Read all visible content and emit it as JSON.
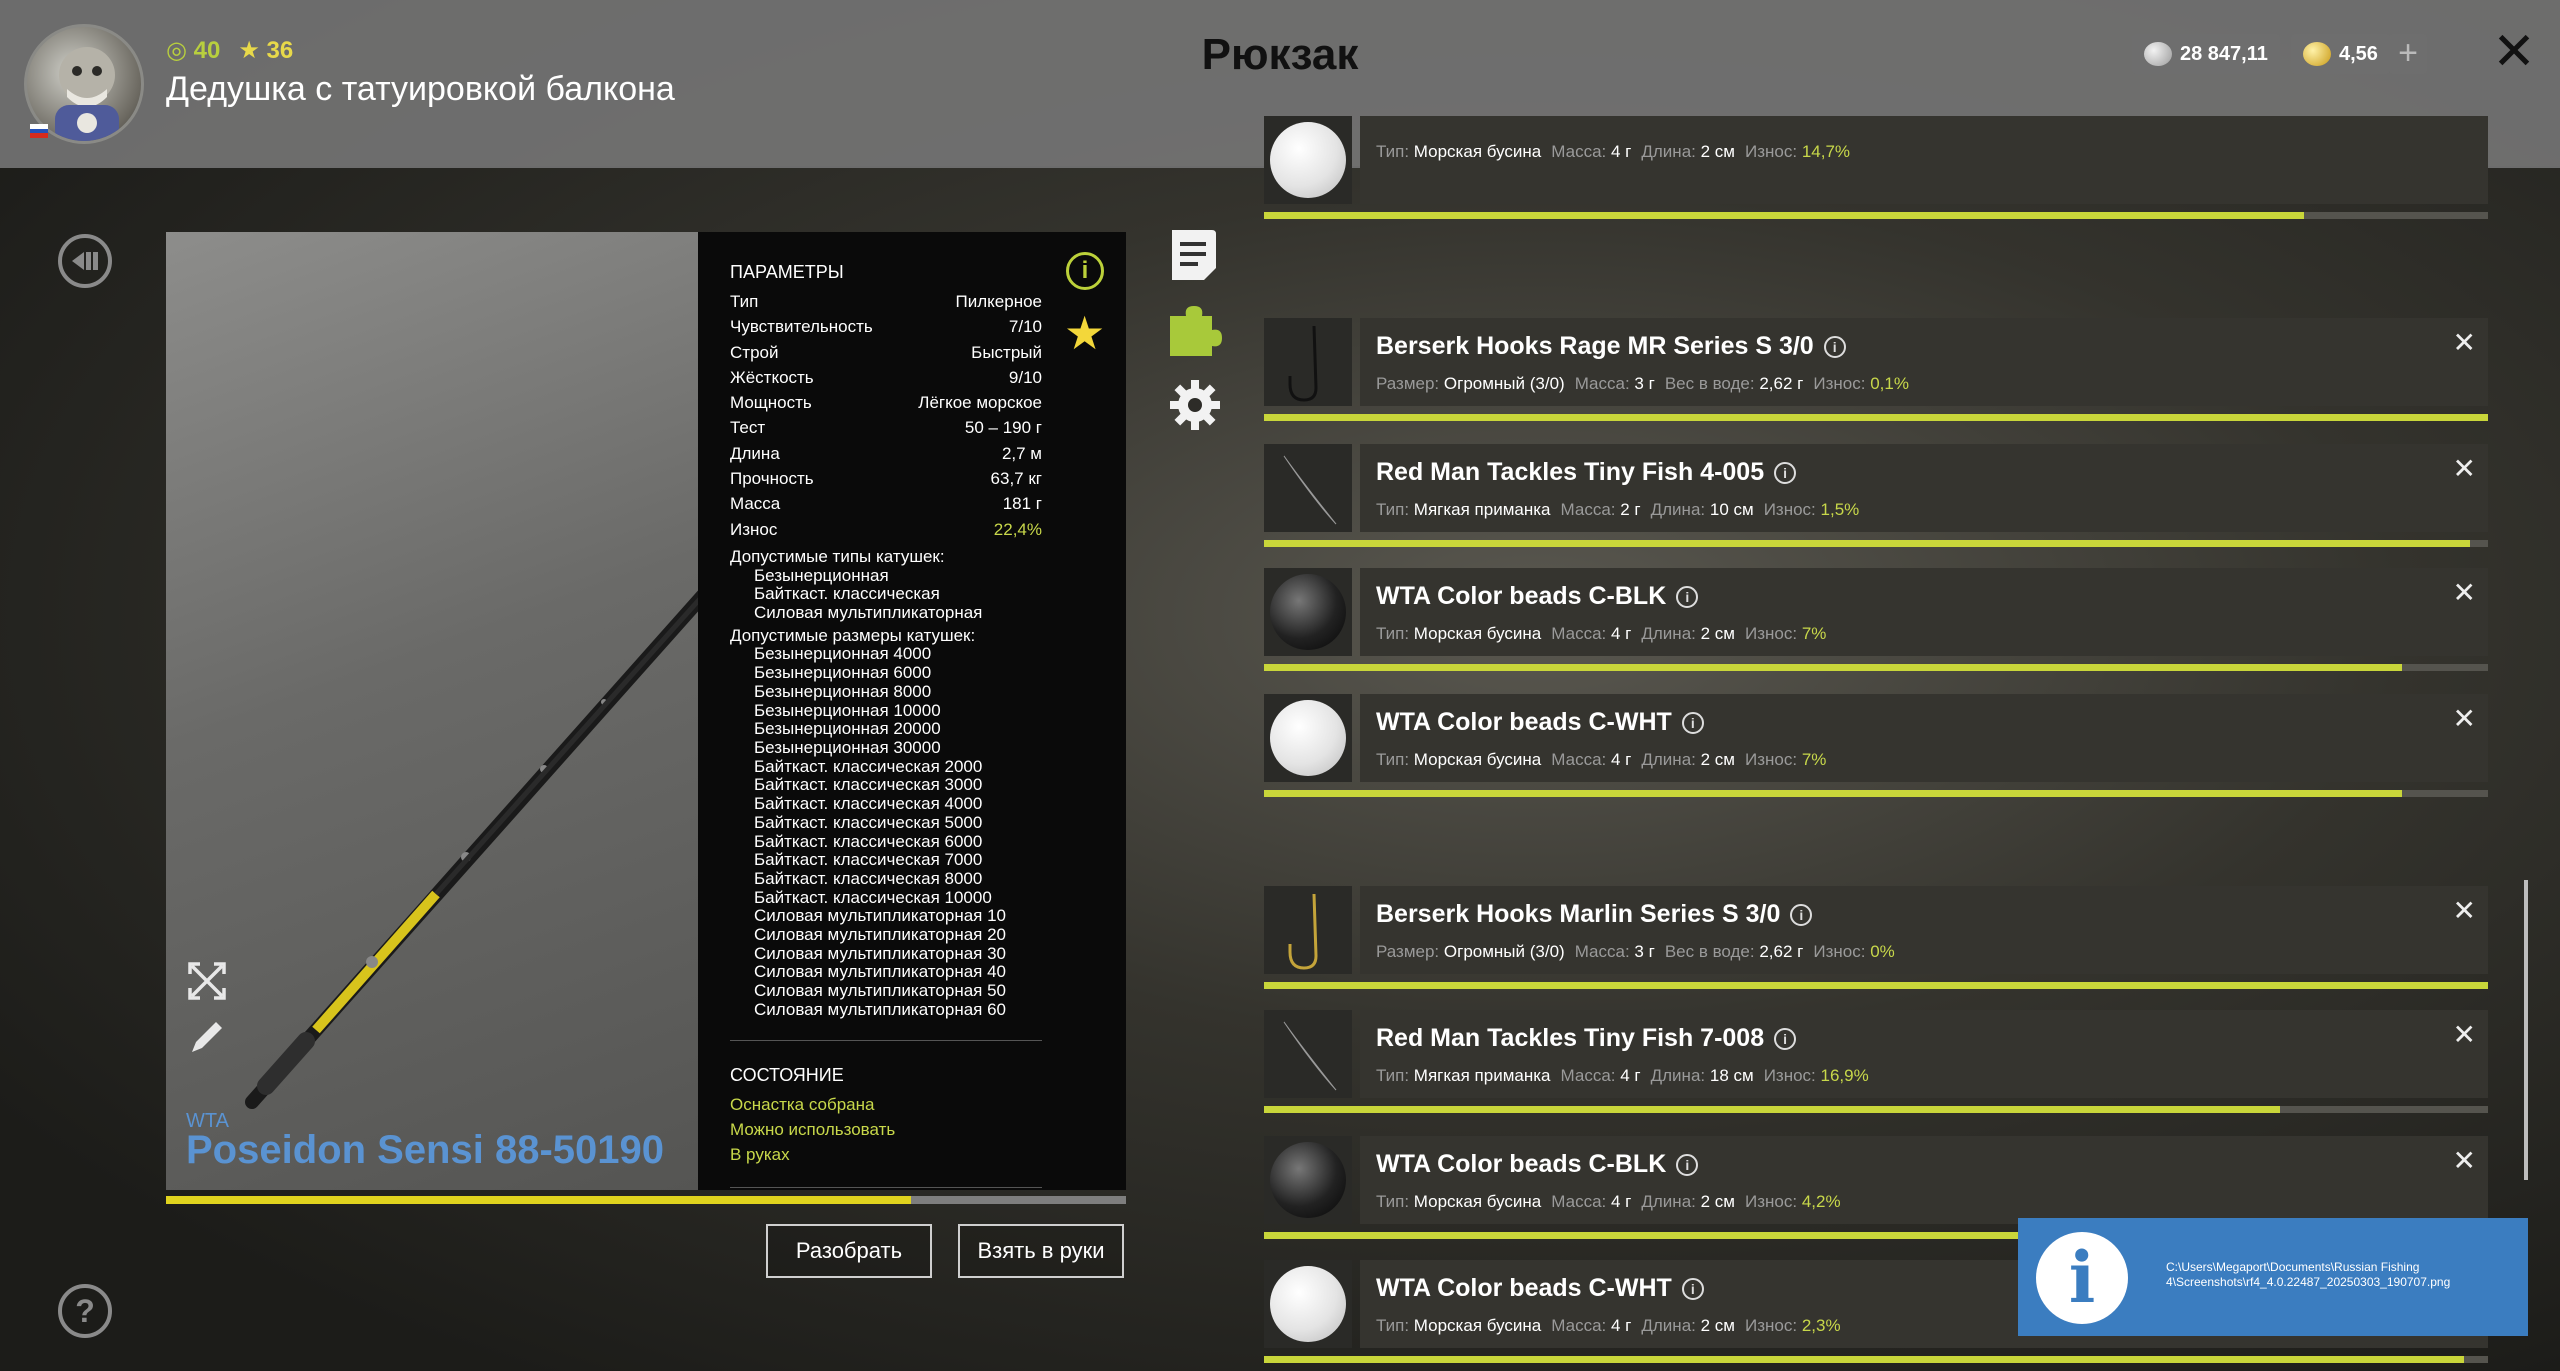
{
  "header": {
    "level": "40",
    "rank": "36",
    "player_name": "Дедушка с татуировкой балкона",
    "title": "Рюкзак",
    "silver": "28 847,11",
    "gold": "4,56",
    "plus": "+",
    "close": "✕"
  },
  "item": {
    "brand": "WTA",
    "name": "Poseidon Sensi 88-50190",
    "wear_fraction": 0.776,
    "params_title": "ПАРАМЕТРЫ",
    "params": [
      {
        "label": "Тип",
        "value": "Пилкерное"
      },
      {
        "label": "Чувствительность",
        "value": "7/10"
      },
      {
        "label": "Строй",
        "value": "Быстрый"
      },
      {
        "label": "Жёсткость",
        "value": "9/10"
      },
      {
        "label": "Мощность",
        "value": "Лёгкое морское"
      },
      {
        "label": "Тест",
        "value": "50 – 190 г"
      },
      {
        "label": "Длина",
        "value": "2,7 м"
      },
      {
        "label": "Прочность",
        "value": "63,7 кг"
      },
      {
        "label": "Масса",
        "value": "181 г"
      },
      {
        "label": "Износ",
        "value": "22,4%"
      }
    ],
    "reel_types_title": "Допустимые типы катушек:",
    "reel_types": [
      "Безынерционная",
      "Байткаст. классическая",
      "Силовая мультипликаторная"
    ],
    "reel_sizes_title": "Допустимые размеры катушек:",
    "reel_sizes": [
      "Безынерционная 4000",
      "Безынерционная 6000",
      "Безынерционная 8000",
      "Безынерционная 10000",
      "Безынерционная 20000",
      "Безынерционная 30000",
      "Байткаст. классическая 2000",
      "Байткаст. классическая 3000",
      "Байткаст. классическая 4000",
      "Байткаст. классическая 5000",
      "Байткаст. классическая 6000",
      "Байткаст. классическая 7000",
      "Байткаст. классическая 8000",
      "Байткаст. классическая 10000",
      "Силовая мультипликаторная 10",
      "Силовая мультипликаторная 20",
      "Силовая мультипликаторная 30",
      "Силовая мультипликаторная 40",
      "Силовая мультипликаторная 50",
      "Силовая мультипликаторная 60"
    ],
    "state_title": "СОСТОЯНИЕ",
    "state": [
      "Оснастка собрана",
      "Можно использовать",
      "В руках"
    ],
    "btn_disassemble": "Разобрать",
    "btn_take": "Взять в руки"
  },
  "list": [
    {
      "thumb": "bead-white",
      "name": "",
      "desc": [
        [
          "Тип:",
          "Морская бусина"
        ],
        [
          "Масса:",
          "4 г"
        ],
        [
          "Длина:",
          "2 см"
        ]
      ],
      "wear_label": "Износ:",
      "wear": "14,7%",
      "bar": 0.85,
      "removable": false
    },
    {
      "thumb": "hook",
      "name": "Berserk Hooks Rage MR Series S 3/0",
      "desc": [
        [
          "Размер:",
          "Огромный (3/0)"
        ],
        [
          "Масса:",
          "3 г"
        ],
        [
          "Вес в воде:",
          "2,62 г"
        ]
      ],
      "wear_label": "Износ:",
      "wear": "0,1%",
      "bar": 1.0,
      "removable": true
    },
    {
      "thumb": "fish",
      "name": "Red Man Tackles Tiny Fish 4-005",
      "desc": [
        [
          "Тип:",
          "Мягкая приманка"
        ],
        [
          "Масса:",
          "2 г"
        ],
        [
          "Длина:",
          "10 см"
        ]
      ],
      "wear_label": "Износ:",
      "wear": "1,5%",
      "bar": 0.985,
      "removable": true
    },
    {
      "thumb": "bead-black",
      "name": "WTA Color beads C-BLK",
      "desc": [
        [
          "Тип:",
          "Морская бусина"
        ],
        [
          "Масса:",
          "4 г"
        ],
        [
          "Длина:",
          "2 см"
        ]
      ],
      "wear_label": "Износ:",
      "wear": "7%",
      "bar": 0.93,
      "removable": true
    },
    {
      "thumb": "bead-white",
      "name": "WTA Color beads C-WHT",
      "desc": [
        [
          "Тип:",
          "Морская бусина"
        ],
        [
          "Масса:",
          "4 г"
        ],
        [
          "Длина:",
          "2 см"
        ]
      ],
      "wear_label": "Износ:",
      "wear": "7%",
      "bar": 0.93,
      "removable": true
    },
    {
      "thumb": "hook-gold",
      "name": "Berserk Hooks Marlin Series S 3/0",
      "desc": [
        [
          "Размер:",
          "Огромный (3/0)"
        ],
        [
          "Масса:",
          "3 г"
        ],
        [
          "Вес в воде:",
          "2,62 г"
        ]
      ],
      "wear_label": "Износ:",
      "wear": "0%",
      "bar": 1.0,
      "removable": true
    },
    {
      "thumb": "fish",
      "name": "Red Man Tackles Tiny Fish 7-008",
      "desc": [
        [
          "Тип:",
          "Мягкая приманка"
        ],
        [
          "Масса:",
          "4 г"
        ],
        [
          "Длина:",
          "18 см"
        ]
      ],
      "wear_label": "Износ:",
      "wear": "16,9%",
      "bar": 0.83,
      "removable": true
    },
    {
      "thumb": "bead-black",
      "name": "WTA Color beads C-BLK",
      "desc": [
        [
          "Тип:",
          "Морская бусина"
        ],
        [
          "Масса:",
          "4 г"
        ],
        [
          "Длина:",
          "2 см"
        ]
      ],
      "wear_label": "Износ:",
      "wear": "4,2%",
      "bar": 0.96,
      "removable": true
    },
    {
      "thumb": "bead-white",
      "name": "WTA Color beads C-WHT",
      "desc": [
        [
          "Тип:",
          "Морская бусина"
        ],
        [
          "Масса:",
          "4 г"
        ],
        [
          "Длина:",
          "2 см"
        ]
      ],
      "wear_label": "Износ:",
      "wear": "2,3%",
      "bar": 0.98,
      "removable": true
    }
  ],
  "notification": {
    "path": "C:\\Users\\Megaport\\Documents\\Russian Fishing 4\\Screenshots\\rf4_4.0.22487_20250303_190707.png"
  },
  "colors": {
    "accent_green": "#c9d63a",
    "accent_yellow": "#e0d31e",
    "brand_blue": "#5a93d2",
    "notify_blue": "#3b7dc0"
  },
  "icons": [
    "back-icon",
    "help-icon",
    "expand-icon",
    "pen-icon",
    "info-icon",
    "favorite-star-icon",
    "notes-icon",
    "puzzle-icon",
    "settings-gear-icon",
    "close-icon"
  ]
}
